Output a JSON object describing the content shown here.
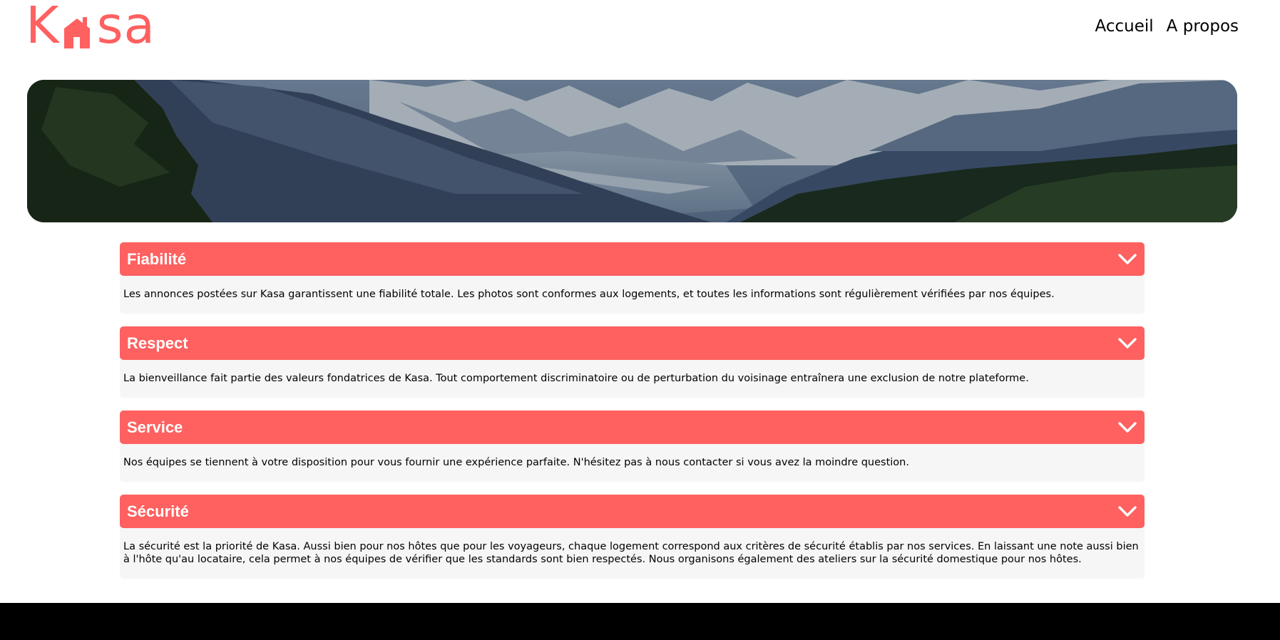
{
  "brand": {
    "logo_prefix": "K",
    "logo_suffix": "sa",
    "logo_icon": "house-icon",
    "accent_color": "#ff6060"
  },
  "nav": {
    "items": [
      {
        "label": "Accueil"
      },
      {
        "label": "A propos"
      }
    ]
  },
  "banner": {
    "image": "mountain-landscape"
  },
  "collapses": [
    {
      "title": "Fiabilité",
      "text": "Les annonces postées sur Kasa garantissent une fiabilité totale. Les photos sont conformes aux logements, et toutes les informations sont régulièrement vérifiées par nos équipes.",
      "icon": "chevron-down-icon"
    },
    {
      "title": "Respect",
      "text": "La bienveillance fait partie des valeurs fondatrices de Kasa. Tout comportement discriminatoire ou de perturbation du voisinage entraînera une exclusion de notre plateforme.",
      "icon": "chevron-down-icon"
    },
    {
      "title": "Service",
      "text": "Nos équipes se tiennent à votre disposition pour vous fournir une expérience parfaite. N'hésitez pas à nous contacter si vous avez la moindre question.",
      "icon": "chevron-down-icon"
    },
    {
      "title": "Sécurité",
      "text": "La sécurité est la priorité de Kasa. Aussi bien pour nos hôtes que pour les voyageurs, chaque logement correspond aux critères de sécurité établis par nos services. En laissant une note aussi bien à l'hôte qu'au locataire, cela permet à nos équipes de vérifier que les standards sont bien respectés. Nous organisons également des ateliers sur la sécurité domestique pour nos hôtes.",
      "icon": "chevron-down-icon"
    }
  ]
}
